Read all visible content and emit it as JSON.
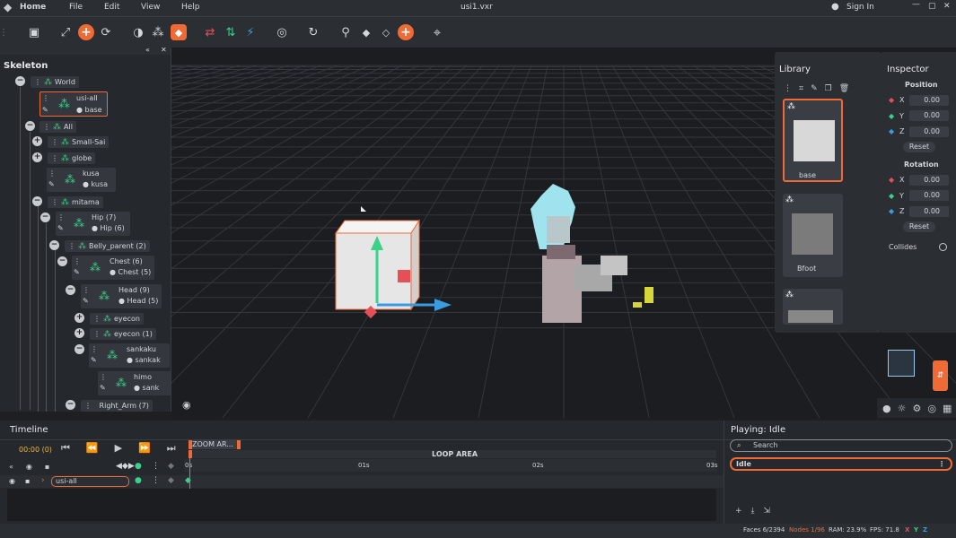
{
  "app": {
    "home_label": "Home",
    "file_title": "usi1.vxr",
    "sign_in": "Sign In"
  },
  "menu": {
    "file": "File",
    "edit": "Edit",
    "view": "View",
    "help": "Help"
  },
  "skeleton": {
    "title": "Skeleton",
    "nodes": {
      "world": "World",
      "usi_all": "usi-all",
      "base": "base",
      "all": "All",
      "small_sai": "Small-Sai",
      "globe": "globe",
      "kusa": "kusa",
      "kusa_sub": "kusa",
      "mitama": "mitama",
      "hip": "Hip (7)",
      "hip_sub": "Hip (6)",
      "belly": "Belly_parent (2)",
      "chest": "Chest (6)",
      "chest_sub": "Chest (5)",
      "head": "Head (9)",
      "head_sub": "Head (5)",
      "eyecon": "eyecon",
      "eyecon1": "eyecon (1)",
      "sankaku": "sankaku",
      "sankaku_sub": "sankak",
      "himo": "himo",
      "himo_sub": "sank",
      "right_arm": "Right_Arm (7)"
    }
  },
  "library": {
    "title": "Library",
    "items": [
      "base",
      "Bfoot"
    ]
  },
  "inspector": {
    "title": "Inspector",
    "position_label": "Position",
    "rotation_label": "Rotation",
    "axes": [
      "X",
      "Y",
      "Z"
    ],
    "position_values": [
      "0.00",
      "0.00",
      "0.00"
    ],
    "rotation_values": [
      "0.00",
      "0.00",
      "0.00"
    ],
    "reset_label": "Reset",
    "collides_label": "Collides"
  },
  "timeline": {
    "title": "Timeline",
    "time": "00:00 (0)",
    "zoom_area": "ZOOM AR...",
    "loop_area": "LOOP AREA",
    "ticks": [
      "0s",
      "01s",
      "02s",
      "03s"
    ],
    "track_name": "usi-all"
  },
  "playing": {
    "title": "Playing: Idle",
    "search_placeholder": "Search",
    "animation": "Idle"
  },
  "status": {
    "faces": "Faces 6/2394",
    "nodes": "Nodes 1/96",
    "ram": "RAM: 23.9%",
    "fps": "FPS: 71.8",
    "x": "X",
    "y": "Y",
    "z": "Z"
  },
  "colors": {
    "accent": "#ef6a35",
    "green": "#3ad28a",
    "red": "#e54f57",
    "blue": "#3a9be0"
  },
  "icons": [
    "logo-icon",
    "save-icon",
    "expand-icon",
    "add-icon",
    "refresh-icon",
    "sphere-icon",
    "nodes-icon",
    "cube-icon",
    "swap-icon",
    "sort-icon",
    "link-icon",
    "globe-icon",
    "loop-icon",
    "tree-icon",
    "box-icon",
    "crosshair-icon"
  ]
}
